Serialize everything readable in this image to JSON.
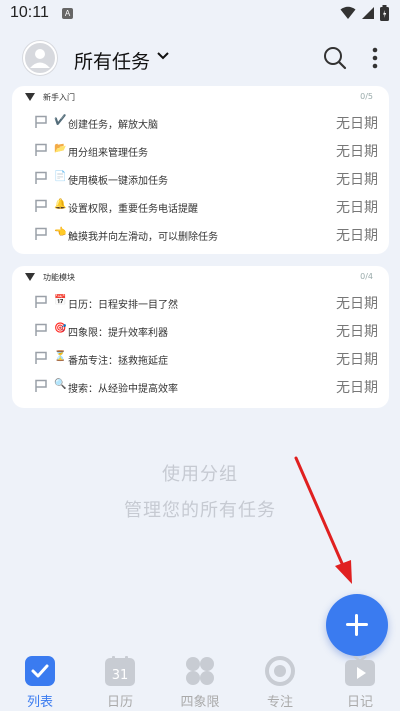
{
  "status_bar": {
    "time": "10:11",
    "notification_letter": "A"
  },
  "header": {
    "title": "所有任务"
  },
  "groups": [
    {
      "name": "新手入门",
      "count": "0/5",
      "tasks": [
        {
          "emoji": "✔️",
          "label": "创建任务，解放大脑",
          "date": "无日期"
        },
        {
          "emoji": "📂",
          "label": "用分组来管理任务",
          "date": "无日期"
        },
        {
          "emoji": "📄",
          "label": "使用模板一键添加任务",
          "date": "无日期"
        },
        {
          "emoji": "🔔",
          "label": "设置权限，重要任务电话提醒",
          "date": "无日期"
        },
        {
          "emoji": "👈",
          "label": "触摸我并向左滑动，可以删除任务",
          "date": "无日期"
        }
      ]
    },
    {
      "name": "功能模块",
      "count": "0/4",
      "tasks": [
        {
          "emoji": "📅",
          "label": "日历：日程安排一目了然",
          "date": "无日期"
        },
        {
          "emoji": "🎯",
          "label": "四象限：提升效率利器",
          "date": "无日期"
        },
        {
          "emoji": "⏳",
          "label": "番茄专注：拯救拖延症",
          "date": "无日期"
        },
        {
          "emoji": "🔍",
          "label": "搜索：从经验中提高效率",
          "date": "无日期"
        }
      ]
    }
  ],
  "empty_hint": {
    "line1": "使用分组",
    "line2": "管理您的所有任务"
  },
  "bottom_nav": {
    "calendar_day": "31",
    "items": [
      {
        "label": "列表",
        "icon": "list-check-icon",
        "active": true
      },
      {
        "label": "日历",
        "icon": "calendar-icon",
        "active": false
      },
      {
        "label": "四象限",
        "icon": "quadrant-icon",
        "active": false
      },
      {
        "label": "专注",
        "icon": "focus-icon",
        "active": false
      },
      {
        "label": "日记",
        "icon": "diary-icon",
        "active": false
      }
    ]
  },
  "colors": {
    "accent": "#3a7bf0",
    "background": "#eef2f9",
    "annotation_arrow": "#e02020"
  }
}
